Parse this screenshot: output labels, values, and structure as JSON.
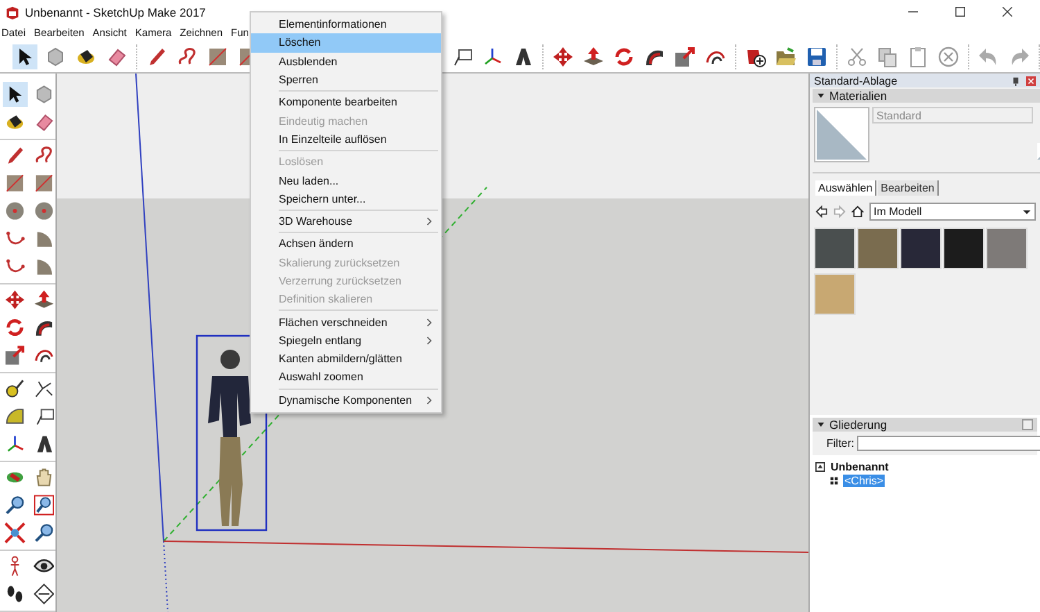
{
  "window": {
    "title": "Unbenannt - SketchUp Make 2017"
  },
  "menu_bar": [
    "Datei",
    "Bearbeiten",
    "Ansicht",
    "Kamera",
    "Zeichnen",
    "Fun"
  ],
  "context_menu": [
    [
      {
        "label": "Elementinformationen",
        "selected": false,
        "disabled": false,
        "submenu": false
      },
      {
        "label": "Löschen",
        "selected": true,
        "disabled": false,
        "submenu": false
      },
      {
        "label": "Ausblenden",
        "selected": false,
        "disabled": false,
        "submenu": false
      },
      {
        "label": "Sperren",
        "selected": false,
        "disabled": false,
        "submenu": false
      }
    ],
    [
      {
        "label": "Komponente bearbeiten",
        "selected": false,
        "disabled": false,
        "submenu": false
      },
      {
        "label": "Eindeutig machen",
        "selected": false,
        "disabled": true,
        "submenu": false
      },
      {
        "label": "In Einzelteile auflösen",
        "selected": false,
        "disabled": false,
        "submenu": false
      }
    ],
    [
      {
        "label": "Loslösen",
        "selected": false,
        "disabled": true,
        "submenu": false
      },
      {
        "label": "Neu laden...",
        "selected": false,
        "disabled": false,
        "submenu": false
      },
      {
        "label": "Speichern unter...",
        "selected": false,
        "disabled": false,
        "submenu": false
      }
    ],
    [
      {
        "label": "3D Warehouse",
        "selected": false,
        "disabled": false,
        "submenu": true
      }
    ],
    [
      {
        "label": "Achsen ändern",
        "selected": false,
        "disabled": false,
        "submenu": false
      },
      {
        "label": "Skalierung zurücksetzen",
        "selected": false,
        "disabled": true,
        "submenu": false
      },
      {
        "label": "Verzerrung zurücksetzen",
        "selected": false,
        "disabled": true,
        "submenu": false
      },
      {
        "label": "Definition skalieren",
        "selected": false,
        "disabled": true,
        "submenu": false
      }
    ],
    [
      {
        "label": "Flächen verschneiden",
        "selected": false,
        "disabled": false,
        "submenu": true
      },
      {
        "label": "Spiegeln entlang",
        "selected": false,
        "disabled": false,
        "submenu": true
      },
      {
        "label": "Kanten abmildern/glätten",
        "selected": false,
        "disabled": false,
        "submenu": false
      },
      {
        "label": "Auswahl zoomen",
        "selected": false,
        "disabled": false,
        "submenu": false
      }
    ],
    [
      {
        "label": "Dynamische Komponenten",
        "selected": false,
        "disabled": false,
        "submenu": true
      }
    ]
  ],
  "tray": {
    "title": "Standard-Ablage",
    "materials": {
      "title": "Materialien",
      "expanded": true,
      "name_placeholder": "Standard",
      "tabs": [
        {
          "label": "Auswählen",
          "selected": true
        },
        {
          "label": "Bearbeiten",
          "selected": false
        }
      ],
      "collection": "Im Modell",
      "swatches": [
        {
          "color": "#4a4f4f"
        },
        {
          "color": "#7a6c4f"
        },
        {
          "color": "#282838"
        },
        {
          "color": "#1c1c1c"
        },
        {
          "color": "#7e7a78"
        },
        {
          "color": "#c8a872"
        }
      ]
    },
    "outliner": {
      "title": "Gliederung",
      "expanded": true,
      "filter_label": "Filter:",
      "tree": [
        {
          "label": "Unbenannt",
          "selected": false,
          "children": [
            {
              "label": "<Chris>",
              "selected": true
            }
          ]
        }
      ]
    }
  }
}
